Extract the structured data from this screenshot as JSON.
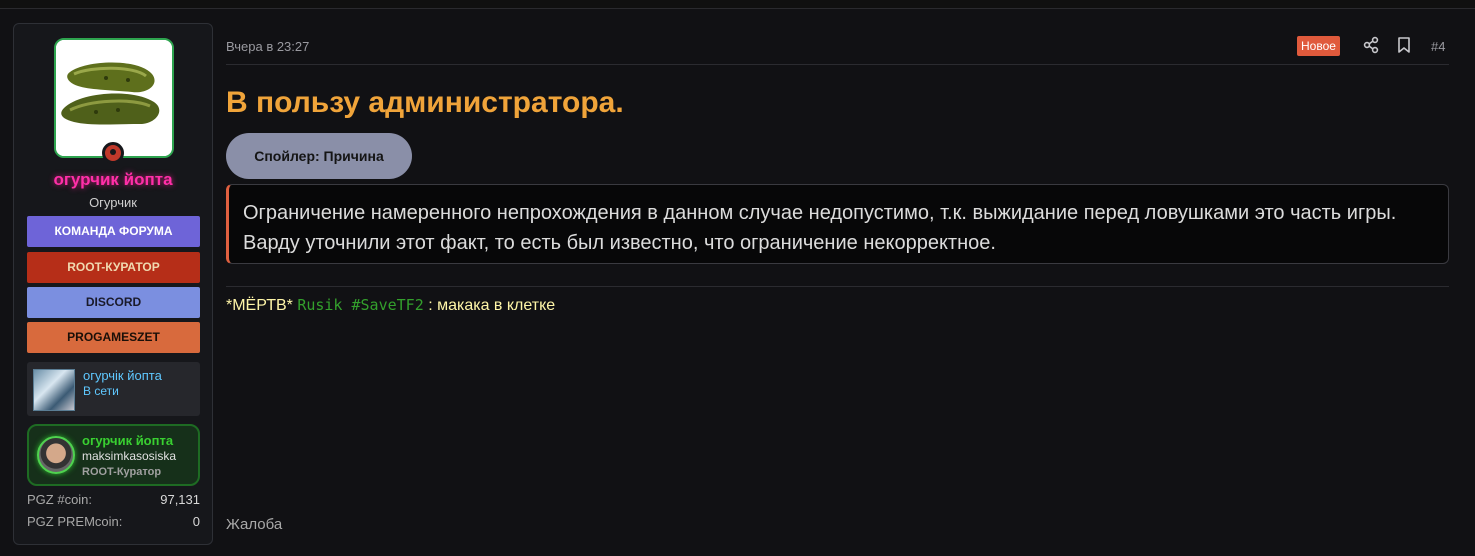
{
  "author": {
    "username": "огурчик йопта",
    "user_title": "Огурчик",
    "badges": [
      "КОМАНДА ФОРУМА",
      "ROOT-КУРАТОР",
      "DISCORD",
      "PROGAMESZET"
    ],
    "linked_account": {
      "name": "огурчік йопта",
      "status": "В сети"
    },
    "steam_card": {
      "name": "огурчик йопта",
      "login": "maksimkasosiska",
      "role": "ROOT-Куратор"
    },
    "stats": [
      {
        "label": "PGZ #coin:",
        "value": "97,131"
      },
      {
        "label": "PGZ PREMcoin:",
        "value": "0"
      }
    ]
  },
  "post": {
    "date": "Вчера в 23:27",
    "new_label": "Новое",
    "number": "#4",
    "title": "В пользу администратора.",
    "spoiler_label": "Спойлер: Причина",
    "spoiler_text": "Ограничение намеренного непрохождения в данном случае недопустимо, т.к. выжидание перед ловушками это часть игры. Варду уточнили этот факт, то есть был известно, что ограничение некорректное.",
    "signature": {
      "prefix": "*МЁРТВ* ",
      "name": "Rusik #SaveTF2",
      "suffix": " : макака в клетке"
    },
    "report_label": "Жалоба"
  },
  "colors": {
    "accent_title": "#f0a43a",
    "username": "#ff2fa8",
    "new_badge": "#e05a3c"
  },
  "icons": {
    "share": "share-icon",
    "bookmark": "bookmark-icon",
    "status": "offline-status-icon"
  }
}
